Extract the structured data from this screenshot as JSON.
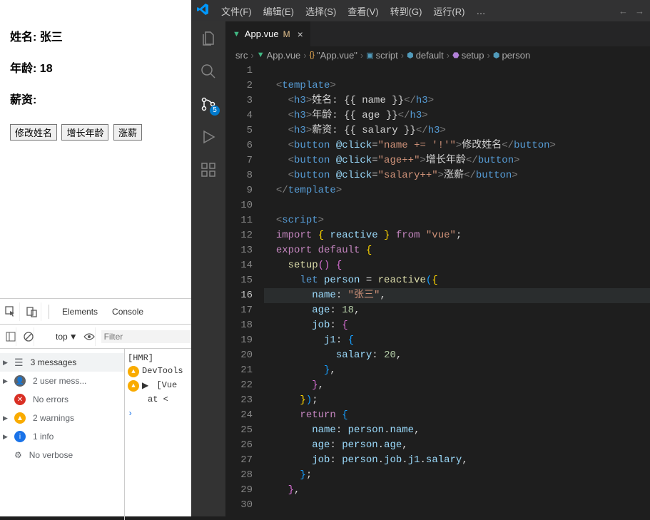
{
  "browser": {
    "labels": {
      "name": "姓名:",
      "age": "年龄:",
      "salary": "薪资:"
    },
    "values": {
      "name": "张三",
      "age": "18",
      "salary": ""
    },
    "buttons": {
      "rename": "修改姓名",
      "incAge": "增长年龄",
      "incSalary": "涨薪"
    }
  },
  "devtools": {
    "tabs": {
      "elements": "Elements",
      "console": "Console"
    },
    "topLabel": "top",
    "filterPlaceholder": "Filter",
    "summary": {
      "messages": "3 messages",
      "user": "2 user mess...",
      "errors": "No errors",
      "warnings": "2 warnings",
      "info": "1 info",
      "verbose": "No verbose"
    },
    "logs": {
      "hmr": "[HMR]",
      "devtools": "DevTools",
      "vueWarn": "[Vue",
      "vueAt": "at <"
    }
  },
  "vscode": {
    "menus": {
      "file": "文件(F)",
      "edit": "编辑(E)",
      "select": "选择(S)",
      "view": "查看(V)",
      "goto": "转到(G)",
      "run": "运行(R)",
      "more": "…"
    },
    "nav": {
      "back": "←",
      "fwd": "→"
    },
    "activity": {
      "scmBadge": "5"
    },
    "tab": {
      "file": "App.vue",
      "mod": "M"
    },
    "breadcrumb": {
      "src": "src",
      "file": "App.vue",
      "scope": "\"App.vue\"",
      "script": "script",
      "default": "default",
      "setup": "setup",
      "person": "person"
    },
    "code": {
      "l1": "",
      "l2_a": "<",
      "l2_b": "template",
      "l2_c": ">",
      "l3_a": "<",
      "l3_b": "h3",
      "l3_c": ">",
      "l3_d": "姓名: ",
      "l3_e": "{{ name }}",
      "l3_f": "</",
      "l3_g": "h3",
      "l3_h": ">",
      "l4_a": "<",
      "l4_b": "h3",
      "l4_c": ">",
      "l4_d": "年龄: ",
      "l4_e": "{{ age }}",
      "l4_f": "</",
      "l4_g": "h3",
      "l4_h": ">",
      "l5_a": "<",
      "l5_b": "h3",
      "l5_c": ">",
      "l5_d": "薪资: ",
      "l5_e": "{{ salary }}",
      "l5_f": "</",
      "l5_g": "h3",
      "l5_h": ">",
      "l6_a": "<",
      "l6_b": "button ",
      "l6_c": "@click",
      "l6_d": "=",
      "l6_e": "\"name += '!'\"",
      "l6_f": ">",
      "l6_g": "修改姓名",
      "l6_h": "</",
      "l6_i": "button",
      "l6_j": ">",
      "l7_a": "<",
      "l7_b": "button ",
      "l7_c": "@click",
      "l7_d": "=",
      "l7_e": "\"age++\"",
      "l7_f": ">",
      "l7_g": "增长年龄",
      "l7_h": "</",
      "l7_i": "button",
      "l7_j": ">",
      "l8_a": "<",
      "l8_b": "button ",
      "l8_c": "@click",
      "l8_d": "=",
      "l8_e": "\"salary++\"",
      "l8_f": ">",
      "l8_g": "涨薪",
      "l8_h": "</",
      "l8_i": "button",
      "l8_j": ">",
      "l9_a": "</",
      "l9_b": "template",
      "l9_c": ">",
      "l11_a": "<",
      "l11_b": "script",
      "l11_c": ">",
      "l12_a": "import ",
      "l12_b": "{ ",
      "l12_c": "reactive ",
      "l12_d": "} ",
      "l12_e": "from ",
      "l12_f": "\"vue\"",
      "l12_g": ";",
      "l13_a": "export default ",
      "l13_b": "{",
      "l14_a": "setup",
      "l14_b": "() ",
      "l14_c": "{",
      "l15_a": "let ",
      "l15_b": "person ",
      "l15_c": "= ",
      "l15_d": "reactive",
      "l15_e": "(",
      "l15_f": "{",
      "l16_a": "name",
      "l16_b": ": ",
      "l16_c": "\"张三\"",
      "l16_d": ",",
      "l17_a": "age",
      "l17_b": ": ",
      "l17_c": "18",
      "l17_d": ",",
      "l18_a": "job",
      "l18_b": ": ",
      "l18_c": "{",
      "l19_a": "j1",
      "l19_b": ": ",
      "l19_c": "{",
      "l20_a": "salary",
      "l20_b": ": ",
      "l20_c": "20",
      "l20_d": ",",
      "l21_a": "}",
      "l21_b": ",",
      "l22_a": "}",
      "l22_b": ",",
      "l23_a": "}",
      "l23_b": ")",
      "l23_c": ";",
      "l24_a": "return ",
      "l24_b": "{",
      "l25_a": "name",
      "l25_b": ": ",
      "l25_c": "person",
      "l25_d": ".",
      "l25_e": "name",
      "l25_f": ",",
      "l26_a": "age",
      "l26_b": ": ",
      "l26_c": "person",
      "l26_d": ".",
      "l26_e": "age",
      "l26_f": ",",
      "l27_a": "job",
      "l27_b": ": ",
      "l27_c": "person",
      "l27_d": ".",
      "l27_e": "job",
      "l27_f": ".",
      "l27_g": "j1",
      "l27_h": ".",
      "l27_i": "salary",
      "l27_j": ",",
      "l28_a": "}",
      "l28_b": ";",
      "l29_a": "}",
      "l29_b": ","
    },
    "lineNumbers": [
      "1",
      "2",
      "3",
      "4",
      "5",
      "6",
      "7",
      "8",
      "9",
      "10",
      "11",
      "12",
      "13",
      "14",
      "15",
      "16",
      "17",
      "18",
      "19",
      "20",
      "21",
      "22",
      "23",
      "24",
      "25",
      "26",
      "27",
      "28",
      "29",
      "30"
    ]
  }
}
